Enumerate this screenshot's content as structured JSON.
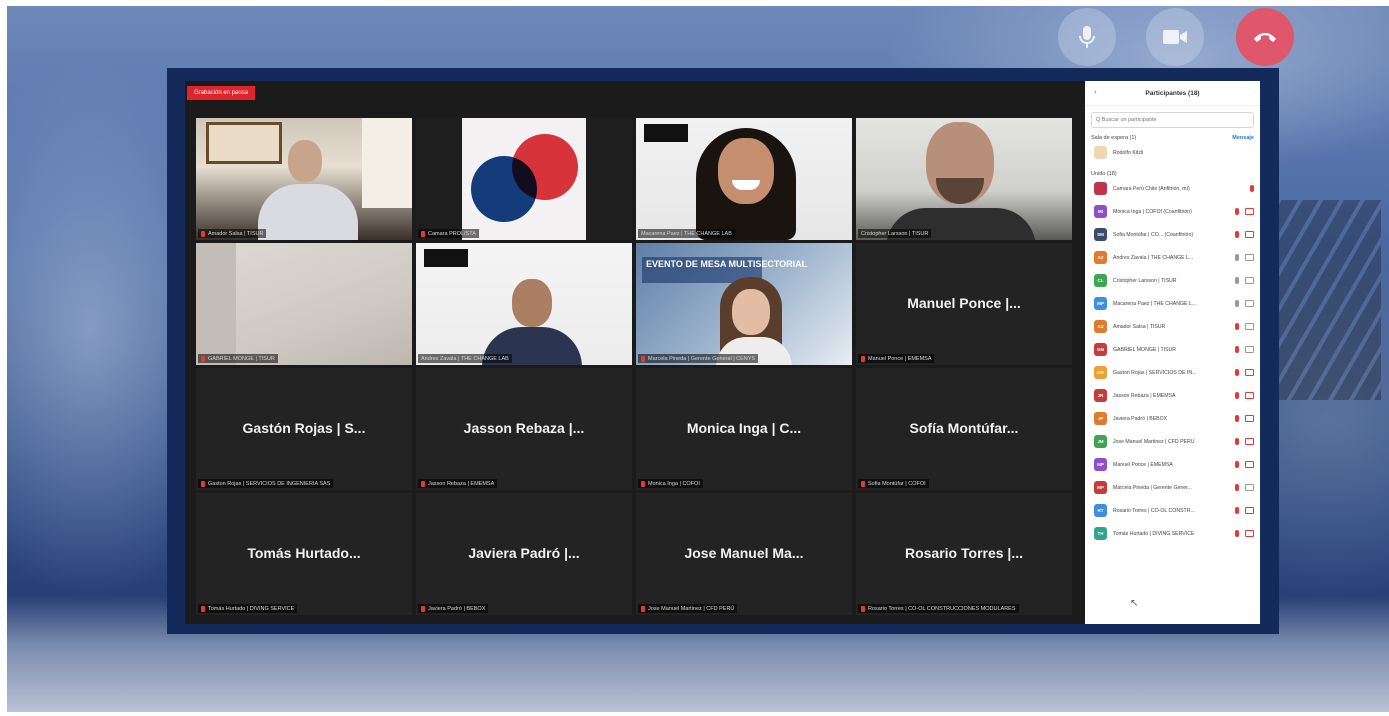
{
  "recording_badge": "Grabación en pausa",
  "tiles": [
    {
      "kind": "video",
      "caption": "Amador Salsa | TISUR",
      "muted": true,
      "active": false
    },
    {
      "kind": "video",
      "caption": "Camara PROLISTA",
      "muted": true,
      "active": false
    },
    {
      "kind": "video",
      "caption": "Macarena Paez | THE CHANGE LAB",
      "muted": false,
      "active": true
    },
    {
      "kind": "video",
      "caption": "Cristopher Larsson | TISUR",
      "muted": false,
      "active": false
    },
    {
      "kind": "video",
      "caption": "GABRIEL MONGE | TISUR",
      "muted": true,
      "active": false
    },
    {
      "kind": "video",
      "caption": "Andres Zavala | THE CHANGE LAB",
      "muted": false,
      "active": false
    },
    {
      "kind": "video",
      "caption": "Marcela Pineda | Gerente General | CENYS",
      "muted": true,
      "active": false,
      "banner": "EVENTO DE MESA MULTISECTORIAL"
    },
    {
      "kind": "name",
      "name": "Manuel Ponce |...",
      "caption": "Manuel Ponce | EMEMSA",
      "muted": true,
      "active": false
    },
    {
      "kind": "name",
      "name": "Gastón Rojas | S...",
      "caption": "Gaston Rojas | SERVICIOS DE INGENIERIA SAS",
      "muted": true,
      "active": false
    },
    {
      "kind": "name",
      "name": "Jasson Rebaza |...",
      "caption": "Jasson Rebaza | EMEMSA",
      "muted": true,
      "active": false
    },
    {
      "kind": "name",
      "name": "Monica Inga | C...",
      "caption": "Monica Inga | COFOI",
      "muted": true,
      "active": false
    },
    {
      "kind": "name",
      "name": "Sofía Montúfar...",
      "caption": "Sofia Montúfar | COFOI",
      "muted": true,
      "active": false
    },
    {
      "kind": "name",
      "name": "Tomás Hurtado...",
      "caption": "Tomás Hurtado | DIVING SERVICE",
      "muted": true,
      "active": false
    },
    {
      "kind": "name",
      "name": "Javiera Padró |...",
      "caption": "Javiera Padró | BEBOX",
      "muted": true,
      "active": false
    },
    {
      "kind": "name",
      "name": "Jose Manuel Ma...",
      "caption": "Jose Manuel Martinez | CFD PERÚ",
      "muted": true,
      "active": false
    },
    {
      "kind": "name",
      "name": "Rosario Torres |...",
      "caption": "Rosario Torres | CO-OL CONSTRUCCIONES MODULARES",
      "muted": true,
      "active": false
    }
  ],
  "panel": {
    "collapse_icon": "chevron-left-icon",
    "title": "Participantes (18)",
    "search_placeholder": "Q Buscar un participante",
    "waiting_label": "Sala de espera (1)",
    "message_button": "Mensaje",
    "waiting_person": "Rodolfo Kitzli",
    "joined_label": "Unido (18)",
    "participants": [
      {
        "initials": "",
        "name": "Camara Perú Chile (Anfitrión, mí)",
        "color": "#c0334a",
        "mic_on": false,
        "cam_on": null
      },
      {
        "initials": "MI",
        "name": "Monica Inga | COFOI (Coanfitrión)",
        "color": "#8f4fc9",
        "mic_on": false,
        "cam_on": false
      },
      {
        "initials": "SM",
        "name": "Sofia Montúfar | CO... (Coanfitrión)",
        "color": "#3d4b6b",
        "mic_on": false,
        "cam_on": false
      },
      {
        "initials": "AZ",
        "name": "Andres Zavala | THE CHANGE L...",
        "color": "#e07a2e",
        "mic_on": true,
        "cam_on": true
      },
      {
        "initials": "CL",
        "name": "Cristopher Larsson | TISUR",
        "color": "#3fa552",
        "mic_on": true,
        "cam_on": true
      },
      {
        "initials": "MP",
        "name": "Macarena Paez | THE CHANGE L...",
        "color": "#3f8ee0",
        "mic_on": true,
        "cam_on": true
      },
      {
        "initials": "AS",
        "name": "Amador Salsa | TISUR",
        "color": "#e07a2e",
        "mic_on": false,
        "cam_on": true
      },
      {
        "initials": "GM",
        "name": "GABRIEL MONGE | TISUR",
        "color": "#c53c3c",
        "mic_on": false,
        "cam_on": true
      },
      {
        "initials": "GR",
        "name": "Gaston Rojas | SERVICIOS DE IN...",
        "color": "#f0a030",
        "mic_on": false,
        "cam_on": false
      },
      {
        "initials": "JR",
        "name": "Jasson Rebaza | EMEMSA",
        "color": "#c53c3c",
        "mic_on": false,
        "cam_on": false
      },
      {
        "initials": "JP",
        "name": "Javiera Padró | BEBOX",
        "color": "#e07a2e",
        "mic_on": false,
        "cam_on": false
      },
      {
        "initials": "JM",
        "name": "Jose Manuel Martinez | CFD PERÚ",
        "color": "#3fa552",
        "mic_on": false,
        "cam_on": false
      },
      {
        "initials": "MP",
        "name": "Manuel Ponce | EMEMSA",
        "color": "#8f4fc9",
        "mic_on": false,
        "cam_on": false
      },
      {
        "initials": "MP",
        "name": "Marcela Pineda | Gerente Gener...",
        "color": "#c53c3c",
        "mic_on": false,
        "cam_on": true
      },
      {
        "initials": "RT",
        "name": "Rosario Torres | CO-OL CONSTR...",
        "color": "#3f8ee0",
        "mic_on": false,
        "cam_on": false
      },
      {
        "initials": "TH",
        "name": "Tomás Hurtado | DIVING SERVICE",
        "color": "#2fa58f",
        "mic_on": false,
        "cam_on": false
      }
    ]
  },
  "background_controls": {
    "mic_icon": "microphone-icon",
    "camera_icon": "video-camera-icon",
    "hangup_icon": "phone-hangup-icon"
  }
}
